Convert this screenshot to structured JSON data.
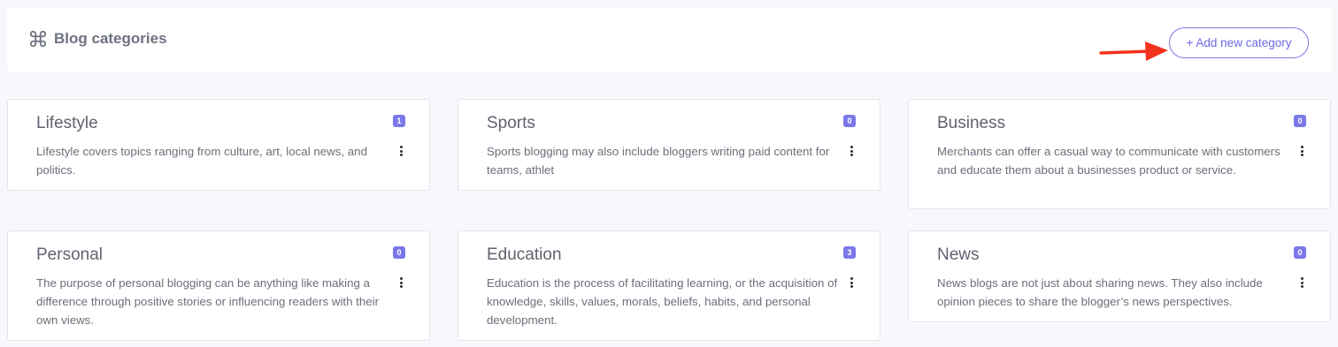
{
  "header": {
    "title": "Blog categories",
    "icon": "command-icon",
    "add_button_label": "+ Add new category",
    "accent_color": "#7a78e8",
    "arrow_color": "#f2321c"
  },
  "categories": [
    {
      "title": "Lifestyle",
      "count": "1",
      "description": "Lifestyle covers topics ranging from culture, art, local news, and politics."
    },
    {
      "title": "Sports",
      "count": "0",
      "description": "Sports blogging may also include bloggers writing paid content for teams, athlet"
    },
    {
      "title": "Business",
      "count": "0",
      "description": "Merchants can offer a casual way to communicate with customers and educate them about a businesses product or service."
    },
    {
      "title": "Personal",
      "count": "0",
      "description": "The purpose of personal blogging can be anything like making a difference through positive stories or influencing readers with their own views."
    },
    {
      "title": "Education",
      "count": "3",
      "description": "Education is the process of facilitating learning, or the acquisition of knowledge, skills, values, morals, beliefs, habits, and personal development."
    },
    {
      "title": "News",
      "count": "0",
      "description": "News blogs are not just about sharing news. They also include opinion pieces to share the blogger’s news perspectives."
    }
  ]
}
